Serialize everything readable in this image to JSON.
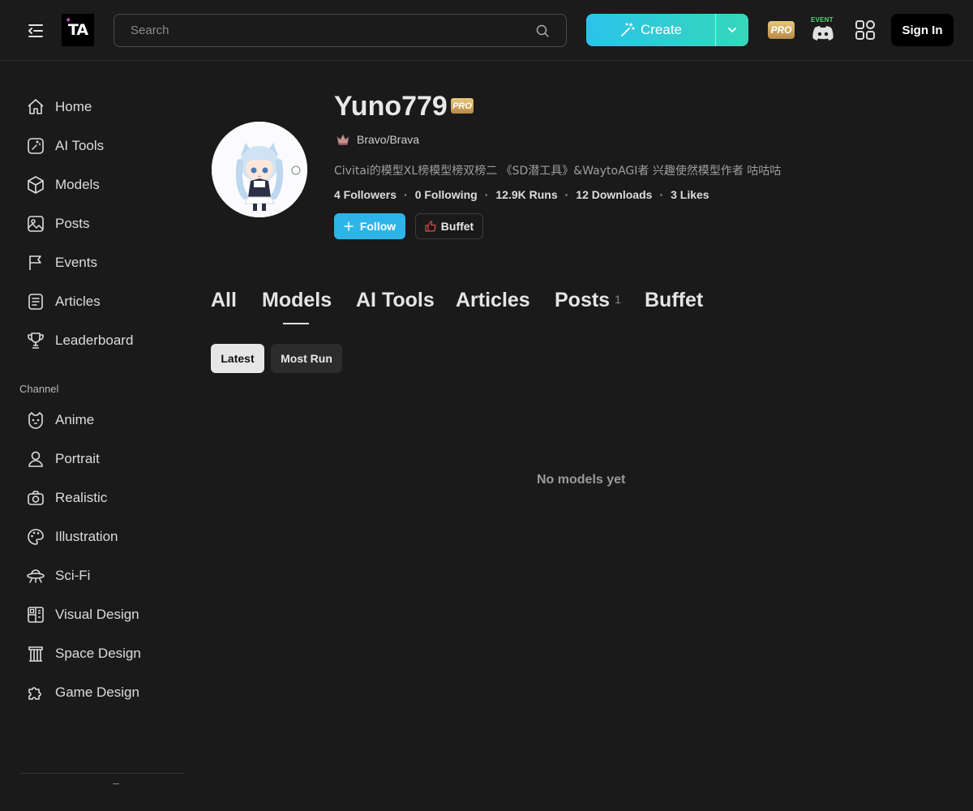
{
  "header": {
    "logo_text": "TA",
    "search_placeholder": "Search",
    "create_label": "Create",
    "pro_label": "PRO",
    "event_label": "EVENT",
    "signin_label": "Sign In",
    "accent_gradient": [
      "#2bc3ea",
      "#37d7b9"
    ]
  },
  "sidebar": {
    "items": [
      {
        "label": "Home",
        "icon": "home-icon"
      },
      {
        "label": "AI Tools",
        "icon": "ai-tools-icon"
      },
      {
        "label": "Models",
        "icon": "cube-icon"
      },
      {
        "label": "Posts",
        "icon": "image-icon"
      },
      {
        "label": "Events",
        "icon": "flag-icon"
      },
      {
        "label": "Articles",
        "icon": "document-icon"
      },
      {
        "label": "Leaderboard",
        "icon": "trophy-icon"
      }
    ],
    "channel_title": "Channel",
    "channels": [
      {
        "label": "Anime",
        "icon": "anime-icon"
      },
      {
        "label": "Portrait",
        "icon": "person-icon"
      },
      {
        "label": "Realistic",
        "icon": "camera-icon"
      },
      {
        "label": "Illustration",
        "icon": "palette-icon"
      },
      {
        "label": "Sci-Fi",
        "icon": "ufo-icon"
      },
      {
        "label": "Visual Design",
        "icon": "layout-icon"
      },
      {
        "label": "Space Design",
        "icon": "column-icon"
      },
      {
        "label": "Game Design",
        "icon": "puzzle-icon"
      }
    ]
  },
  "profile": {
    "username": "Yuno779",
    "pro_badge": "PRO",
    "rank_title": "Bravo/Brava",
    "bio": "Civitai的模型XL榜模型榜双榜二 《SD潜工具》&WaytoAGI者 兴趣使然模型作者 咕咕咕",
    "stats": [
      "4 Followers",
      "0 Following",
      "12.9K Runs",
      "12 Downloads",
      "3 Likes"
    ],
    "follow_label": "Follow",
    "buffet_label": "Buffet"
  },
  "tabs": [
    {
      "label": "All",
      "count": ""
    },
    {
      "label": "Models",
      "count": ""
    },
    {
      "label": "AI Tools",
      "count": ""
    },
    {
      "label": "Articles",
      "count": ""
    },
    {
      "label": "Posts",
      "count": "1"
    },
    {
      "label": "Buffet",
      "count": ""
    }
  ],
  "active_tab": "Models",
  "sort": {
    "latest": "Latest",
    "most_run": "Most Run",
    "selected": "Latest"
  },
  "empty_message": "No models yet"
}
